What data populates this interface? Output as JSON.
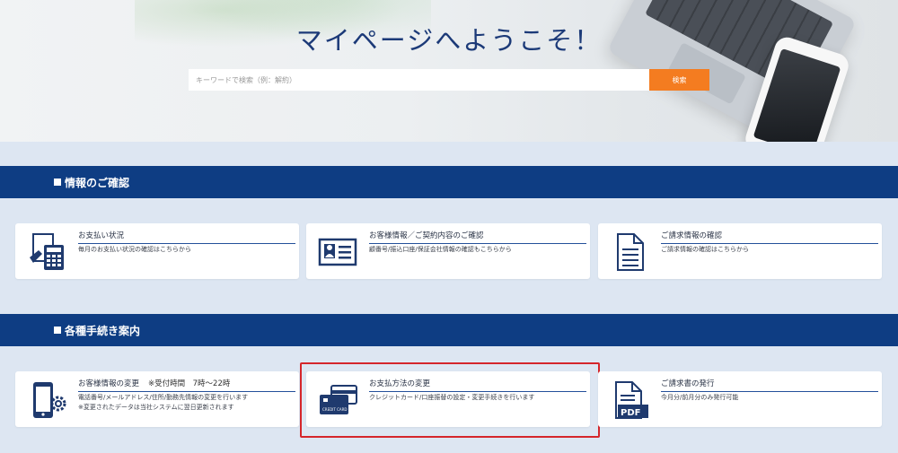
{
  "hero": {
    "title": "マイページへようこそ！",
    "search_placeholder": "キーワードで検索（例：解約）",
    "search_button": "検索"
  },
  "sections": [
    {
      "title": "情報のご確認",
      "cards": [
        {
          "icon": "calculator-icon",
          "title": "お支払い状況",
          "desc": [
            "毎月のお支払い状況の確認はこちらから"
          ]
        },
        {
          "icon": "id-card-icon",
          "title": "お客様情報／ご契約内容のご確認",
          "desc": [
            "顧番号/振込口座/保証会社情報の確認もこちらから"
          ]
        },
        {
          "icon": "document-icon",
          "title": "ご請求情報の確認",
          "desc": [
            "ご請求情報の確認はこちらから"
          ]
        }
      ]
    },
    {
      "title": "各種手続き案内",
      "cards": [
        {
          "icon": "phone-settings-icon",
          "title": "お客様情報の変更",
          "title_sub": "※受付時間　7時～22時",
          "desc": [
            "電話番号/メールアドレス/住所/勤務先情報の変更を行います",
            "※変更されたデータは当社システムに翌日更新されます"
          ]
        },
        {
          "icon": "credit-card-icon",
          "title": "お支払方法の変更",
          "desc": [
            "クレジットカード/口座振替の設定・変更手続きを行います"
          ]
        },
        {
          "icon": "pdf-icon",
          "title": "ご請求書の発行",
          "desc": [
            "今月分/前月分のみ発行可能"
          ]
        }
      ]
    }
  ],
  "icon_text": {
    "card_label": "CREDIT CARD",
    "pdf_label": "PDF"
  },
  "colors": {
    "section_bar": "#0e3d83",
    "accent": "#f47c20",
    "highlight_border": "#d5262b",
    "title": "#1c3a78"
  }
}
